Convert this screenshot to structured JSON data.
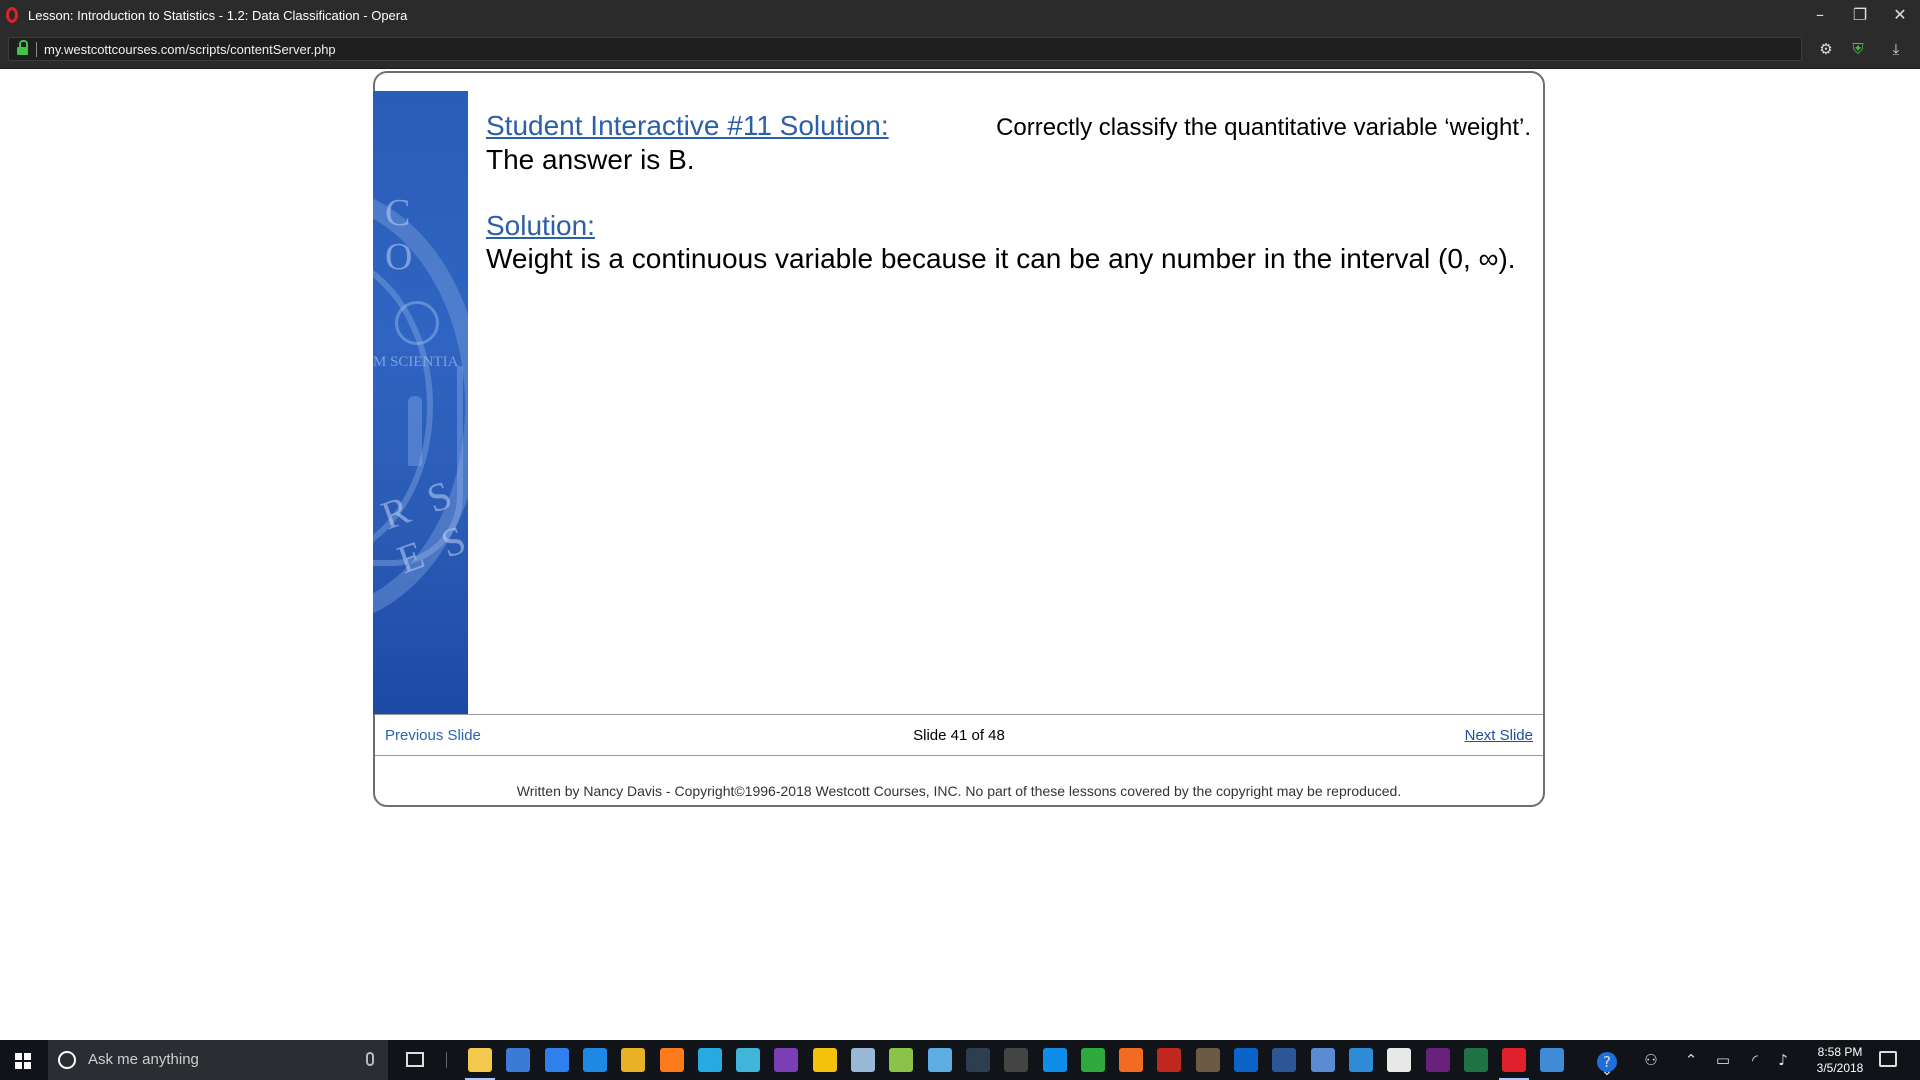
{
  "window": {
    "title": "Lesson: Introduction to Statistics - 1.2: Data Classification - Opera",
    "minimize_icon": "minimize-icon",
    "restore_icon": "restore-icon",
    "close_icon": "close-icon"
  },
  "addressbar": {
    "url": "my.westcottcourses.com/scripts/contentServer.php",
    "icons": [
      "lock-icon",
      "settings-icon",
      "vpn-shield-icon",
      "download-icon"
    ]
  },
  "slide": {
    "heading": "Student Interactive #11 Solution:",
    "answer": "The answer is B.",
    "prompt": "Correctly classify the quantitative variable ‘weight’.",
    "solution_label": "Solution:",
    "solution_text": "Weight is a continuous variable because it can be any number in the interval (0, ∞).",
    "seal_text_top": "C O",
    "seal_text_middle": "M SCIENTIA",
    "seal_text_bottom": "R S E S"
  },
  "navigation": {
    "previous": "Previous Slide",
    "position": "Slide 41 of 48",
    "next": "Next Slide"
  },
  "footer": {
    "copyright": "Written by Nancy Davis - Copyright©1996-2018 Westcott Courses, INC. No part of these lessons covered by the copyright may be reproduced."
  },
  "taskbar": {
    "search_placeholder": "Ask me anything",
    "time": "8:58 PM",
    "date": "3/5/2018",
    "apps": [
      {
        "name": "file-explorer-icon",
        "color": "#f2c94c"
      },
      {
        "name": "store-icon",
        "color": "#3a7bd5"
      },
      {
        "name": "vscode-icon",
        "color": "#2f80ed"
      },
      {
        "name": "edge-icon",
        "color": "#1e88e5"
      },
      {
        "name": "chrome-icon",
        "color": "#e9b125"
      },
      {
        "name": "firefox-icon",
        "color": "#ff7a1a"
      },
      {
        "name": "ie-icon",
        "color": "#27a9e1"
      },
      {
        "name": "app-icon",
        "color": "#3fb6d9"
      },
      {
        "name": "dp-app-icon",
        "color": "#7b3fb5"
      },
      {
        "name": "star-app-icon",
        "color": "#f4c20d"
      },
      {
        "name": "paint-icon",
        "color": "#9ab8d8"
      },
      {
        "name": "lambda-app-icon",
        "color": "#8bc34a"
      },
      {
        "name": "notes-app-icon",
        "color": "#5dade2"
      },
      {
        "name": "code-app-icon",
        "color": "#2c3e50"
      },
      {
        "name": "calculator-icon",
        "color": "#444444"
      },
      {
        "name": "teamviewer-icon",
        "color": "#0e8ee9"
      },
      {
        "name": "camtasia-icon",
        "color": "#2eaa3d"
      },
      {
        "name": "xampp-icon",
        "color": "#f26b21"
      },
      {
        "name": "filezilla-icon",
        "color": "#c0281f"
      },
      {
        "name": "media-app-icon",
        "color": "#6b5b45"
      },
      {
        "name": "outlook-icon",
        "color": "#0a64c8"
      },
      {
        "name": "word-icon",
        "color": "#2b5797"
      },
      {
        "name": "network-app-icon",
        "color": "#5b8bd0"
      },
      {
        "name": "remote-app-icon",
        "color": "#2e8bd6"
      },
      {
        "name": "mail-icon",
        "color": "#e8e8e8"
      },
      {
        "name": "visual-studio-icon",
        "color": "#68217a"
      },
      {
        "name": "excel-icon",
        "color": "#1f7244"
      },
      {
        "name": "opera-icon",
        "color": "#e0202a"
      },
      {
        "name": "screen-app-icon",
        "color": "#3f8bd8"
      }
    ],
    "tray_icons": [
      "help-icon",
      "people-icon",
      "chevron-up-icon",
      "battery-icon",
      "wifi-icon",
      "volume-icon"
    ]
  }
}
